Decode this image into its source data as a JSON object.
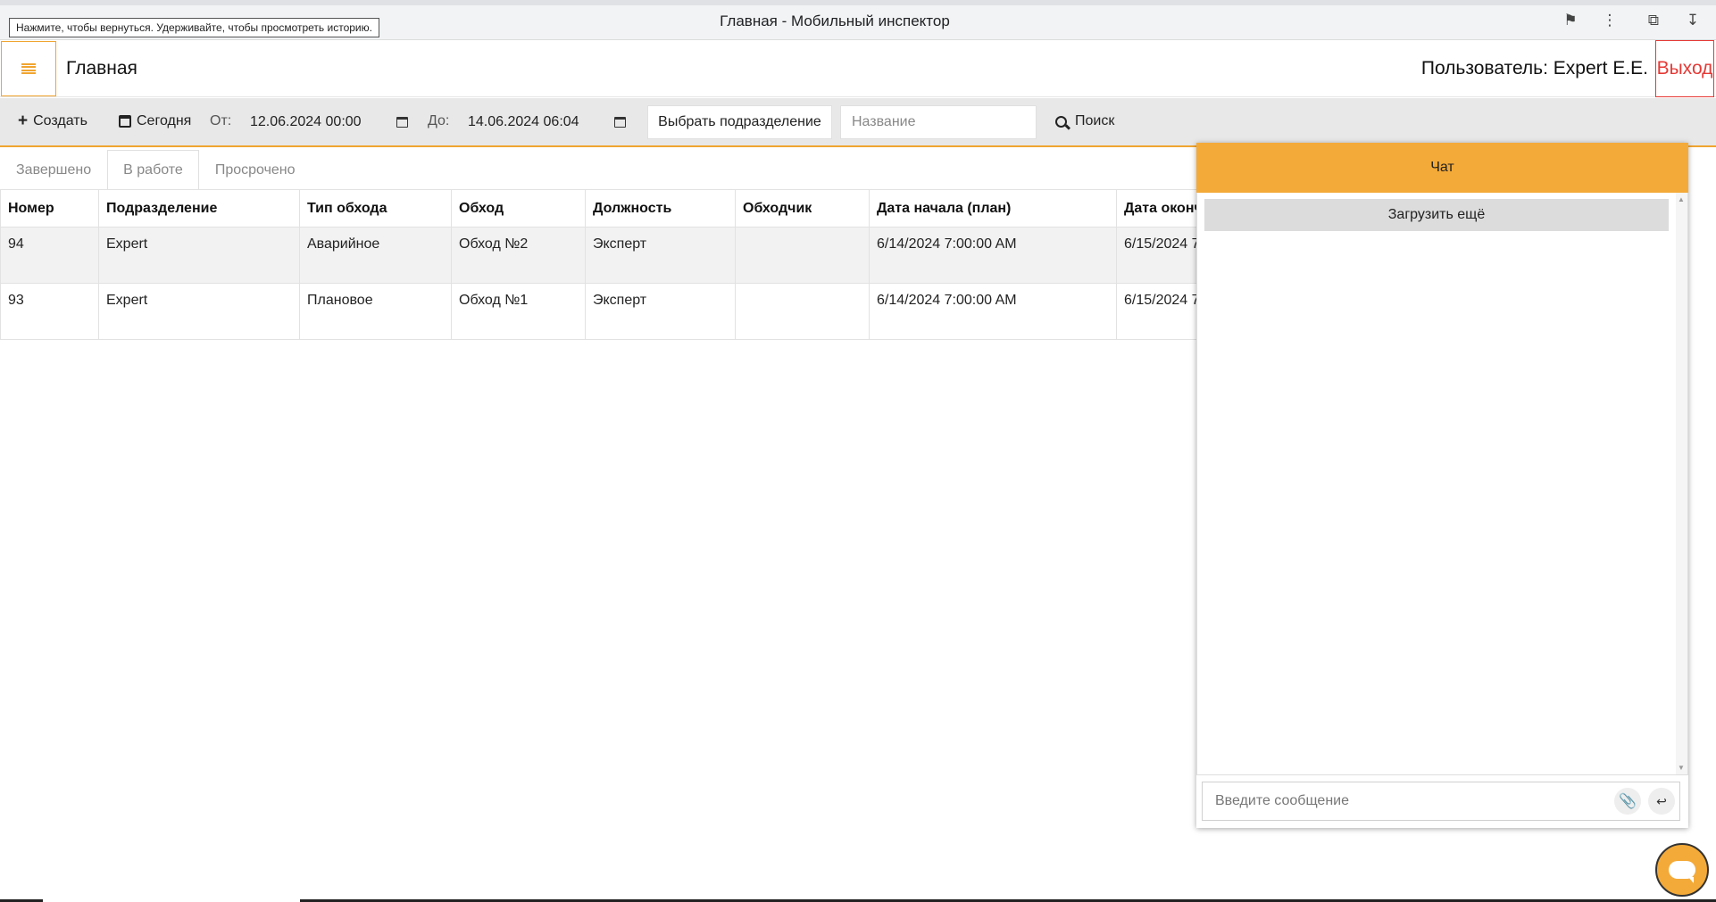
{
  "browser": {
    "title": "Главная - Мобильный инспектор",
    "tooltip": "Нажмите, чтобы вернуться. Удерживайте, чтобы просмотреть историю."
  },
  "header": {
    "title": "Главная",
    "user": "Пользователь: Expert E.E.",
    "logout": "Выход",
    "accent_color": "#f0a531",
    "logout_color": "#e53935"
  },
  "toolbar": {
    "create": "Создать",
    "today": "Сегодня",
    "from_label": "От:",
    "from_value": "12.06.2024 00:00",
    "to_label": "До:",
    "to_value": "14.06.2024 06:04",
    "subdivision": "Выбрать подразделение",
    "name_placeholder": "Название",
    "search": "Поиск"
  },
  "tabs": [
    {
      "label": "Завершено",
      "active": false
    },
    {
      "label": "В работе",
      "active": true
    },
    {
      "label": "Просрочено",
      "active": false
    }
  ],
  "table": {
    "columns": [
      "Номер",
      "Подразделение",
      "Тип обхода",
      "Обход",
      "Должность",
      "Обходчик",
      "Дата начала (план)",
      "Дата оконч"
    ],
    "rows": [
      [
        "94",
        "Expert",
        "Аварийное",
        "Обход №2",
        "Эксперт",
        "",
        "6/14/2024 7:00:00 AM",
        "6/15/2024 7"
      ],
      [
        "93",
        "Expert",
        "Плановое",
        "Обход №1",
        "Эксперт",
        "",
        "6/14/2024 7:00:00 AM",
        "6/15/2024 7"
      ]
    ]
  },
  "chat": {
    "title": "Чат",
    "load_more": "Загрузить ещё",
    "input_placeholder": "Введите сообщение",
    "header_color": "#f4aa38"
  }
}
